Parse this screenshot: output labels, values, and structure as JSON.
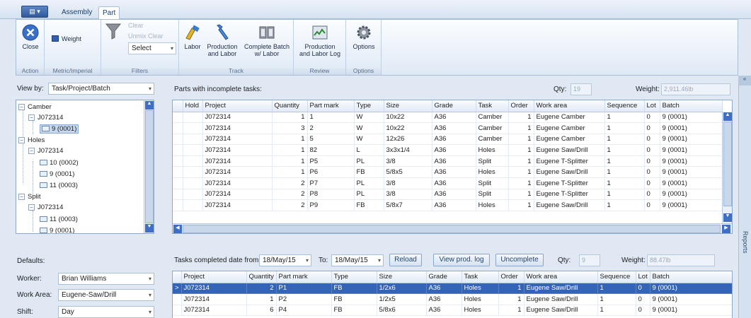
{
  "app_button": "▤ ▾",
  "tabs": [
    {
      "label": "Assembly"
    },
    {
      "label": "Part"
    }
  ],
  "ribbon": {
    "groups": {
      "action": "Action",
      "metric": "Metric/Imperial",
      "filters": "Filters",
      "track": "Track",
      "review": "Review",
      "options": "Options"
    },
    "close": "Close",
    "weight": "Weight",
    "clear": "Clear",
    "unmix_clear": "Unmix Clear",
    "select": "Select",
    "labor": "Labor",
    "production_labor": [
      "Production",
      "and Labor"
    ],
    "complete_batch": [
      "Complete Batch",
      "w/ Labor"
    ],
    "production_log": [
      "Production",
      "and Labor Log"
    ],
    "options": "Options"
  },
  "view_by": {
    "label": "View by:",
    "value": "Task/Project/Batch"
  },
  "tree": [
    {
      "label": "Camber"
    },
    {
      "label": "J072314"
    },
    {
      "label": "9 (0001)"
    },
    {
      "label": "Holes"
    },
    {
      "label": "J072314"
    },
    {
      "label": "10 (0002)"
    },
    {
      "label": "9 (0001)"
    },
    {
      "label": "11 (0003)"
    },
    {
      "label": "Split"
    },
    {
      "label": "J072314"
    },
    {
      "label": "11 (0003)"
    },
    {
      "label": "9 (0001)"
    }
  ],
  "incomplete": {
    "title": "Parts with incomplete tasks:",
    "qty_label": "Qty:",
    "qty_value": "19",
    "weight_label": "Weight:",
    "weight_value": "2,911.46lb",
    "columns": [
      "",
      "Hold",
      "Project",
      "Quantity",
      "Part mark",
      "Type",
      "Size",
      "Grade",
      "Task",
      "Order",
      "Work area",
      "Sequence",
      "Lot",
      "Batch"
    ],
    "rows": [
      [
        "",
        "",
        "J072314",
        "1",
        "1",
        "W",
        "10x22",
        "A36",
        "Camber",
        "1",
        "Eugene Camber",
        "1",
        "0",
        "9 (0001)"
      ],
      [
        "",
        "",
        "J072314",
        "3",
        "2",
        "W",
        "10x22",
        "A36",
        "Camber",
        "1",
        "Eugene Camber",
        "1",
        "0",
        "9 (0001)"
      ],
      [
        "",
        "",
        "J072314",
        "1",
        "5",
        "W",
        "12x26",
        "A36",
        "Camber",
        "1",
        "Eugene Camber",
        "1",
        "0",
        "9 (0001)"
      ],
      [
        "",
        "",
        "J072314",
        "1",
        "82",
        "L",
        "3x3x1/4",
        "A36",
        "Holes",
        "1",
        "Eugene Saw/Drill",
        "1",
        "0",
        "9 (0001)"
      ],
      [
        "",
        "",
        "J072314",
        "1",
        "P5",
        "PL",
        "3/8",
        "A36",
        "Split",
        "1",
        "Eugene T-Splitter",
        "1",
        "0",
        "9 (0001)"
      ],
      [
        "",
        "",
        "J072314",
        "1",
        "P6",
        "FB",
        "5/8x5",
        "A36",
        "Holes",
        "1",
        "Eugene Saw/Drill",
        "1",
        "0",
        "9 (0001)"
      ],
      [
        "",
        "",
        "J072314",
        "2",
        "P7",
        "PL",
        "3/8",
        "A36",
        "Split",
        "1",
        "Eugene T-Splitter",
        "1",
        "0",
        "9 (0001)"
      ],
      [
        "",
        "",
        "J072314",
        "2",
        "P8",
        "PL",
        "3/8",
        "A36",
        "Split",
        "1",
        "Eugene T-Splitter",
        "1",
        "0",
        "9 (0001)"
      ],
      [
        "",
        "",
        "J072314",
        "2",
        "P9",
        "FB",
        "5/8x7",
        "A36",
        "Holes",
        "1",
        "Eugene Saw/Drill",
        "1",
        "0",
        "9 (0001)"
      ]
    ]
  },
  "defaults": {
    "title": "Defaults:",
    "worker_label": "Worker:",
    "worker_value": "Brian Williams",
    "work_area_label": "Work Area:",
    "work_area_value": "Eugene-Saw/Drill",
    "shift_label": "Shift:",
    "shift_value": "Day"
  },
  "completed": {
    "from_label": "Tasks completed date from:",
    "from_value": "18/May/15",
    "to_label": "To:",
    "to_value": "18/May/15",
    "reload": "Reload",
    "view_log": "View prod. log",
    "uncomplete": "Uncomplete",
    "qty_label": "Qty:",
    "qty_value": "9",
    "weight_label": "Weight:",
    "weight_value": "88.47lb",
    "columns": [
      "",
      "Project",
      "Quantity",
      "Part mark",
      "Type",
      "Size",
      "Grade",
      "Task",
      "Order",
      "Work area",
      "Sequence",
      "Lot",
      "Batch"
    ],
    "rows": [
      [
        ">",
        "J072314",
        "2",
        "P1",
        "FB",
        "1/2x6",
        "A36",
        "Holes",
        "1",
        "Eugene Saw/Drill",
        "1",
        "0",
        "9 (0001)"
      ],
      [
        "",
        "J072314",
        "1",
        "P2",
        "FB",
        "1/2x5",
        "A36",
        "Holes",
        "1",
        "Eugene Saw/Drill",
        "1",
        "0",
        "9 (0001)"
      ],
      [
        "",
        "J072314",
        "6",
        "P4",
        "FB",
        "5/8x6",
        "A36",
        "Holes",
        "1",
        "Eugene Saw/Drill",
        "1",
        "0",
        "9 (0001)"
      ]
    ]
  },
  "side_panel": "Reports",
  "colors": {
    "accent": "#3464b8",
    "ribbon": "#dfe9f5",
    "background": "#dfe8f3"
  }
}
